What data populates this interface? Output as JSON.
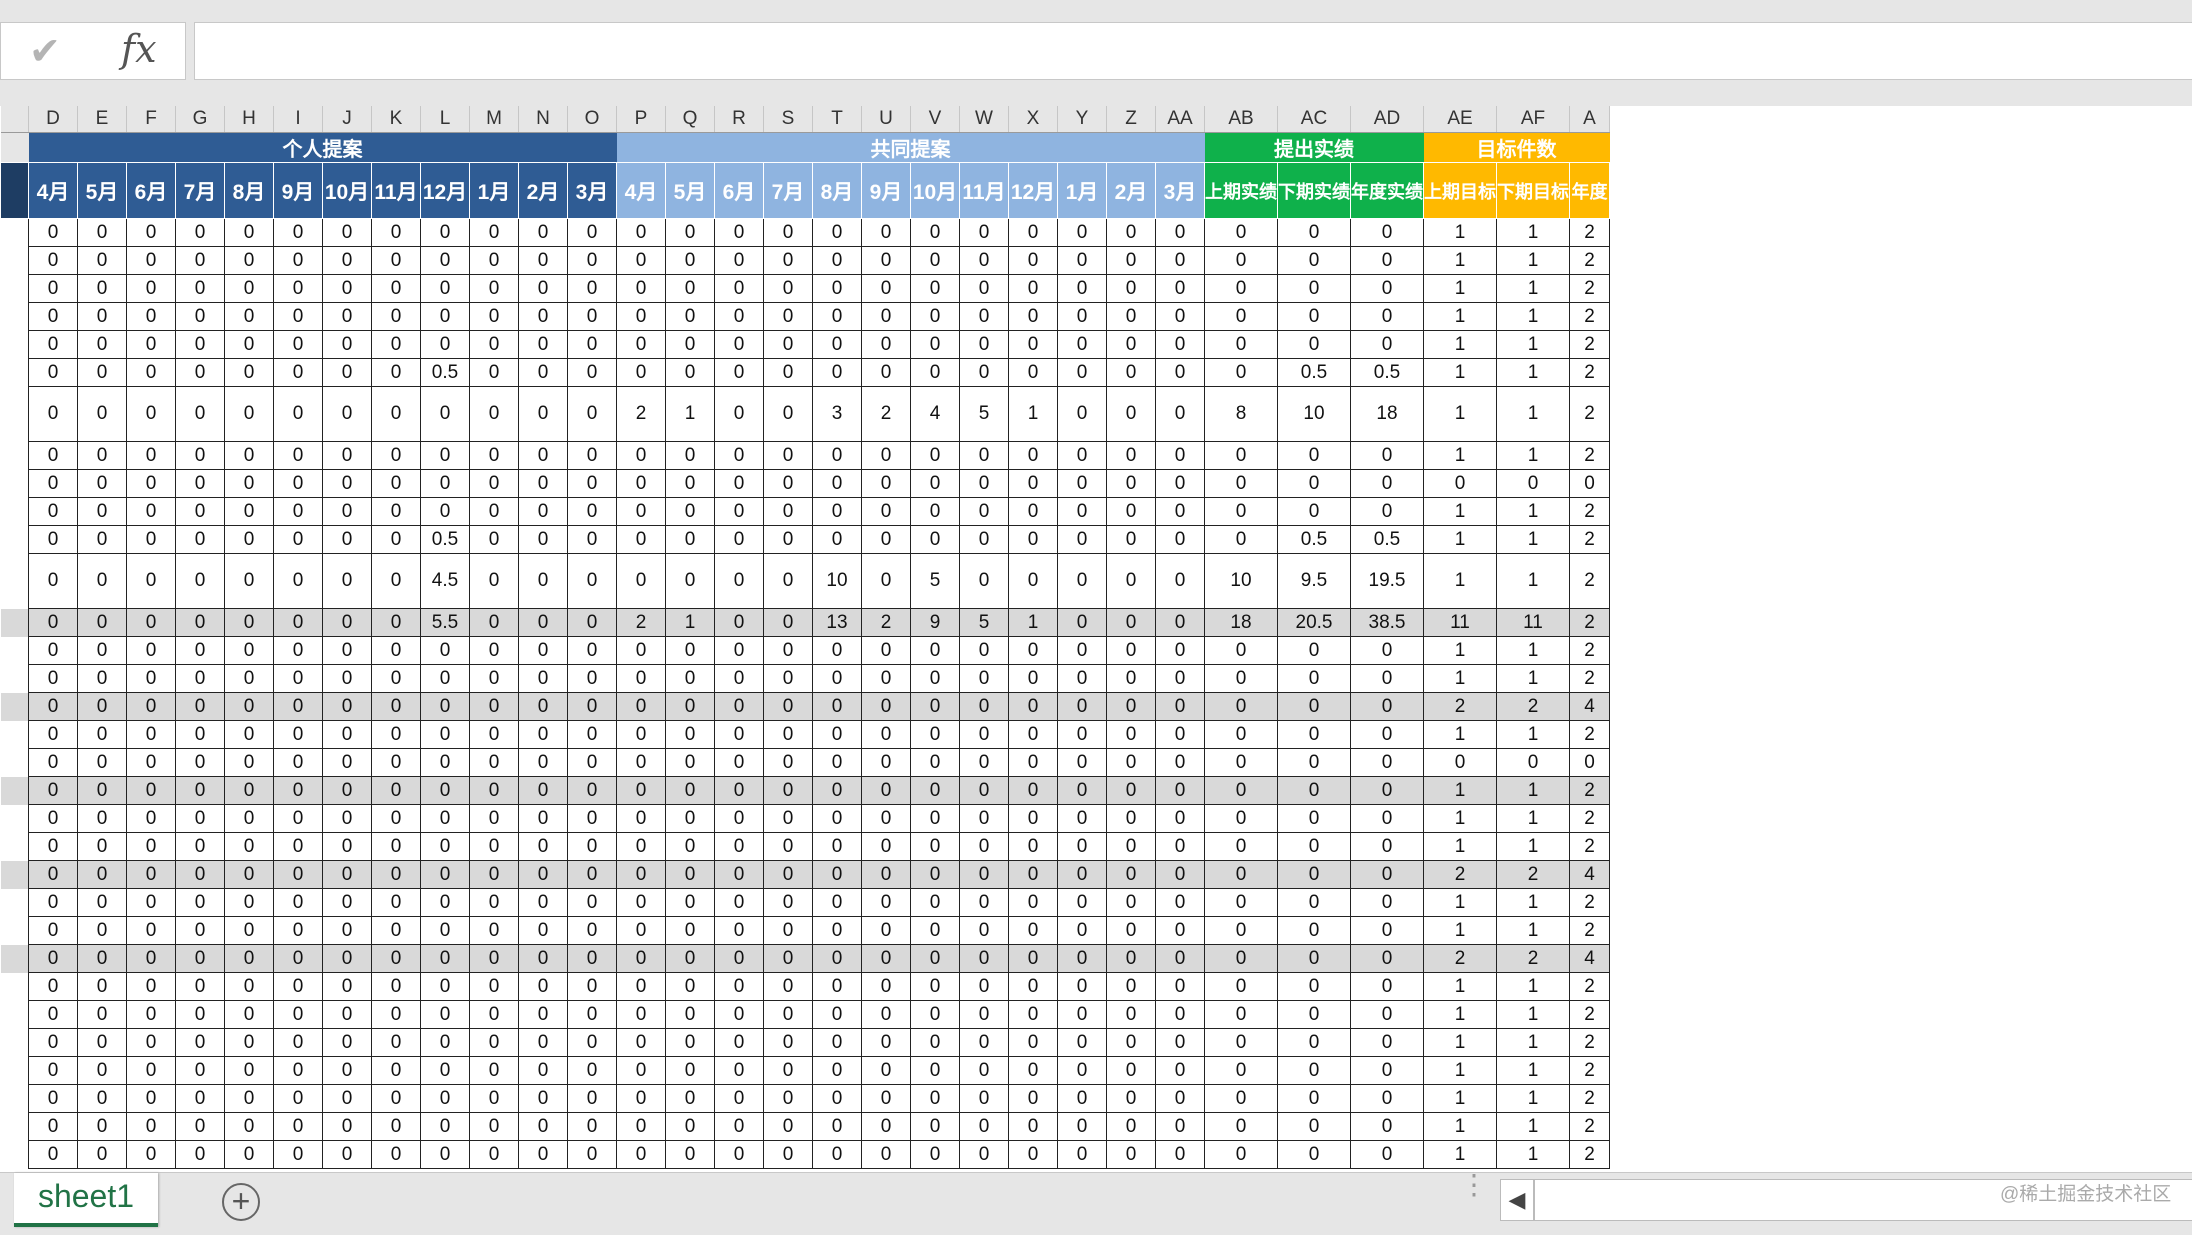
{
  "formula_bar": {
    "check_glyph": "✔",
    "fx_glyph": "fx",
    "value": ""
  },
  "col_letters": [
    "D",
    "E",
    "F",
    "G",
    "H",
    "I",
    "J",
    "K",
    "L",
    "M",
    "N",
    "O",
    "P",
    "Q",
    "R",
    "S",
    "T",
    "U",
    "V",
    "W",
    "X",
    "Y",
    "Z",
    "AA",
    "AB",
    "AC",
    "AD",
    "AE",
    "AF",
    "A"
  ],
  "groups": [
    {
      "label": "个人提案",
      "span": 12,
      "color": "#2f5c94"
    },
    {
      "label": "共同提案",
      "span": 12,
      "color": "#8fb4e0"
    },
    {
      "label": "提出实绩",
      "span": 3,
      "color": "#0fb14b"
    },
    {
      "label": "目标件数",
      "span": 3,
      "color": "#ffb900"
    }
  ],
  "month_headers": [
    "4月",
    "5月",
    "6月",
    "7月",
    "8月",
    "9月",
    "10月",
    "11月",
    "12月",
    "1月",
    "2月",
    "3月",
    "4月",
    "5月",
    "6月",
    "7月",
    "8月",
    "9月",
    "10月",
    "11月",
    "12月",
    "1月",
    "2月",
    "3月",
    "上期实绩",
    "下期实绩",
    "年度实绩",
    "上期目标",
    "下期目标",
    "年度"
  ],
  "rows": [
    {
      "h": 28,
      "s": 0,
      "c": [
        "0",
        "0",
        "0",
        "0",
        "0",
        "0",
        "0",
        "0",
        "0",
        "0",
        "0",
        "0",
        "0",
        "0",
        "0",
        "0",
        "0",
        "0",
        "0",
        "0",
        "0",
        "0",
        "0",
        "0",
        "0",
        "0",
        "0",
        "1",
        "1",
        "2"
      ]
    },
    {
      "h": 28,
      "s": 0,
      "c": [
        "0",
        "0",
        "0",
        "0",
        "0",
        "0",
        "0",
        "0",
        "0",
        "0",
        "0",
        "0",
        "0",
        "0",
        "0",
        "0",
        "0",
        "0",
        "0",
        "0",
        "0",
        "0",
        "0",
        "0",
        "0",
        "0",
        "0",
        "1",
        "1",
        "2"
      ]
    },
    {
      "h": 28,
      "s": 0,
      "c": [
        "0",
        "0",
        "0",
        "0",
        "0",
        "0",
        "0",
        "0",
        "0",
        "0",
        "0",
        "0",
        "0",
        "0",
        "0",
        "0",
        "0",
        "0",
        "0",
        "0",
        "0",
        "0",
        "0",
        "0",
        "0",
        "0",
        "0",
        "1",
        "1",
        "2"
      ]
    },
    {
      "h": 28,
      "s": 0,
      "c": [
        "0",
        "0",
        "0",
        "0",
        "0",
        "0",
        "0",
        "0",
        "0",
        "0",
        "0",
        "0",
        "0",
        "0",
        "0",
        "0",
        "0",
        "0",
        "0",
        "0",
        "0",
        "0",
        "0",
        "0",
        "0",
        "0",
        "0",
        "1",
        "1",
        "2"
      ]
    },
    {
      "h": 28,
      "s": 0,
      "c": [
        "0",
        "0",
        "0",
        "0",
        "0",
        "0",
        "0",
        "0",
        "0",
        "0",
        "0",
        "0",
        "0",
        "0",
        "0",
        "0",
        "0",
        "0",
        "0",
        "0",
        "0",
        "0",
        "0",
        "0",
        "0",
        "0",
        "0",
        "1",
        "1",
        "2"
      ]
    },
    {
      "h": 28,
      "s": 0,
      "c": [
        "0",
        "0",
        "0",
        "0",
        "0",
        "0",
        "0",
        "0",
        "0.5",
        "0",
        "0",
        "0",
        "0",
        "0",
        "0",
        "0",
        "0",
        "0",
        "0",
        "0",
        "0",
        "0",
        "0",
        "0",
        "0",
        "0.5",
        "0.5",
        "1",
        "1",
        "2"
      ]
    },
    {
      "h": 55,
      "s": 0,
      "c": [
        "0",
        "0",
        "0",
        "0",
        "0",
        "0",
        "0",
        "0",
        "0",
        "0",
        "0",
        "0",
        "2",
        "1",
        "0",
        "0",
        "3",
        "2",
        "4",
        "5",
        "1",
        "0",
        "0",
        "0",
        "8",
        "10",
        "18",
        "1",
        "1",
        "2"
      ]
    },
    {
      "h": 28,
      "s": 0,
      "c": [
        "0",
        "0",
        "0",
        "0",
        "0",
        "0",
        "0",
        "0",
        "0",
        "0",
        "0",
        "0",
        "0",
        "0",
        "0",
        "0",
        "0",
        "0",
        "0",
        "0",
        "0",
        "0",
        "0",
        "0",
        "0",
        "0",
        "0",
        "1",
        "1",
        "2"
      ]
    },
    {
      "h": 28,
      "s": 0,
      "c": [
        "0",
        "0",
        "0",
        "0",
        "0",
        "0",
        "0",
        "0",
        "0",
        "0",
        "0",
        "0",
        "0",
        "0",
        "0",
        "0",
        "0",
        "0",
        "0",
        "0",
        "0",
        "0",
        "0",
        "0",
        "0",
        "0",
        "0",
        "0",
        "0",
        "0"
      ]
    },
    {
      "h": 28,
      "s": 0,
      "c": [
        "0",
        "0",
        "0",
        "0",
        "0",
        "0",
        "0",
        "0",
        "0",
        "0",
        "0",
        "0",
        "0",
        "0",
        "0",
        "0",
        "0",
        "0",
        "0",
        "0",
        "0",
        "0",
        "0",
        "0",
        "0",
        "0",
        "0",
        "1",
        "1",
        "2"
      ]
    },
    {
      "h": 28,
      "s": 0,
      "c": [
        "0",
        "0",
        "0",
        "0",
        "0",
        "0",
        "0",
        "0",
        "0.5",
        "0",
        "0",
        "0",
        "0",
        "0",
        "0",
        "0",
        "0",
        "0",
        "0",
        "0",
        "0",
        "0",
        "0",
        "0",
        "0",
        "0.5",
        "0.5",
        "1",
        "1",
        "2"
      ]
    },
    {
      "h": 55,
      "s": 0,
      "c": [
        "0",
        "0",
        "0",
        "0",
        "0",
        "0",
        "0",
        "0",
        "4.5",
        "0",
        "0",
        "0",
        "0",
        "0",
        "0",
        "0",
        "10",
        "0",
        "5",
        "0",
        "0",
        "0",
        "0",
        "0",
        "10",
        "9.5",
        "19.5",
        "1",
        "1",
        "2"
      ]
    },
    {
      "h": 28,
      "s": 1,
      "c": [
        "0",
        "0",
        "0",
        "0",
        "0",
        "0",
        "0",
        "0",
        "5.5",
        "0",
        "0",
        "0",
        "2",
        "1",
        "0",
        "0",
        "13",
        "2",
        "9",
        "5",
        "1",
        "0",
        "0",
        "0",
        "18",
        "20.5",
        "38.5",
        "11",
        "11",
        "2"
      ]
    },
    {
      "h": 28,
      "s": 0,
      "c": [
        "0",
        "0",
        "0",
        "0",
        "0",
        "0",
        "0",
        "0",
        "0",
        "0",
        "0",
        "0",
        "0",
        "0",
        "0",
        "0",
        "0",
        "0",
        "0",
        "0",
        "0",
        "0",
        "0",
        "0",
        "0",
        "0",
        "0",
        "1",
        "1",
        "2"
      ]
    },
    {
      "h": 28,
      "s": 0,
      "c": [
        "0",
        "0",
        "0",
        "0",
        "0",
        "0",
        "0",
        "0",
        "0",
        "0",
        "0",
        "0",
        "0",
        "0",
        "0",
        "0",
        "0",
        "0",
        "0",
        "0",
        "0",
        "0",
        "0",
        "0",
        "0",
        "0",
        "0",
        "1",
        "1",
        "2"
      ]
    },
    {
      "h": 28,
      "s": 1,
      "c": [
        "0",
        "0",
        "0",
        "0",
        "0",
        "0",
        "0",
        "0",
        "0",
        "0",
        "0",
        "0",
        "0",
        "0",
        "0",
        "0",
        "0",
        "0",
        "0",
        "0",
        "0",
        "0",
        "0",
        "0",
        "0",
        "0",
        "0",
        "2",
        "2",
        "4"
      ]
    },
    {
      "h": 28,
      "s": 0,
      "c": [
        "0",
        "0",
        "0",
        "0",
        "0",
        "0",
        "0",
        "0",
        "0",
        "0",
        "0",
        "0",
        "0",
        "0",
        "0",
        "0",
        "0",
        "0",
        "0",
        "0",
        "0",
        "0",
        "0",
        "0",
        "0",
        "0",
        "0",
        "1",
        "1",
        "2"
      ]
    },
    {
      "h": 28,
      "s": 0,
      "c": [
        "0",
        "0",
        "0",
        "0",
        "0",
        "0",
        "0",
        "0",
        "0",
        "0",
        "0",
        "0",
        "0",
        "0",
        "0",
        "0",
        "0",
        "0",
        "0",
        "0",
        "0",
        "0",
        "0",
        "0",
        "0",
        "0",
        "0",
        "0",
        "0",
        "0"
      ]
    },
    {
      "h": 28,
      "s": 1,
      "c": [
        "0",
        "0",
        "0",
        "0",
        "0",
        "0",
        "0",
        "0",
        "0",
        "0",
        "0",
        "0",
        "0",
        "0",
        "0",
        "0",
        "0",
        "0",
        "0",
        "0",
        "0",
        "0",
        "0",
        "0",
        "0",
        "0",
        "0",
        "1",
        "1",
        "2"
      ]
    },
    {
      "h": 28,
      "s": 0,
      "c": [
        "0",
        "0",
        "0",
        "0",
        "0",
        "0",
        "0",
        "0",
        "0",
        "0",
        "0",
        "0",
        "0",
        "0",
        "0",
        "0",
        "0",
        "0",
        "0",
        "0",
        "0",
        "0",
        "0",
        "0",
        "0",
        "0",
        "0",
        "1",
        "1",
        "2"
      ]
    },
    {
      "h": 28,
      "s": 0,
      "c": [
        "0",
        "0",
        "0",
        "0",
        "0",
        "0",
        "0",
        "0",
        "0",
        "0",
        "0",
        "0",
        "0",
        "0",
        "0",
        "0",
        "0",
        "0",
        "0",
        "0",
        "0",
        "0",
        "0",
        "0",
        "0",
        "0",
        "0",
        "1",
        "1",
        "2"
      ]
    },
    {
      "h": 28,
      "s": 1,
      "c": [
        "0",
        "0",
        "0",
        "0",
        "0",
        "0",
        "0",
        "0",
        "0",
        "0",
        "0",
        "0",
        "0",
        "0",
        "0",
        "0",
        "0",
        "0",
        "0",
        "0",
        "0",
        "0",
        "0",
        "0",
        "0",
        "0",
        "0",
        "2",
        "2",
        "4"
      ]
    },
    {
      "h": 28,
      "s": 0,
      "c": [
        "0",
        "0",
        "0",
        "0",
        "0",
        "0",
        "0",
        "0",
        "0",
        "0",
        "0",
        "0",
        "0",
        "0",
        "0",
        "0",
        "0",
        "0",
        "0",
        "0",
        "0",
        "0",
        "0",
        "0",
        "0",
        "0",
        "0",
        "1",
        "1",
        "2"
      ]
    },
    {
      "h": 28,
      "s": 0,
      "c": [
        "0",
        "0",
        "0",
        "0",
        "0",
        "0",
        "0",
        "0",
        "0",
        "0",
        "0",
        "0",
        "0",
        "0",
        "0",
        "0",
        "0",
        "0",
        "0",
        "0",
        "0",
        "0",
        "0",
        "0",
        "0",
        "0",
        "0",
        "1",
        "1",
        "2"
      ]
    },
    {
      "h": 28,
      "s": 1,
      "c": [
        "0",
        "0",
        "0",
        "0",
        "0",
        "0",
        "0",
        "0",
        "0",
        "0",
        "0",
        "0",
        "0",
        "0",
        "0",
        "0",
        "0",
        "0",
        "0",
        "0",
        "0",
        "0",
        "0",
        "0",
        "0",
        "0",
        "0",
        "2",
        "2",
        "4"
      ]
    },
    {
      "h": 28,
      "s": 0,
      "c": [
        "0",
        "0",
        "0",
        "0",
        "0",
        "0",
        "0",
        "0",
        "0",
        "0",
        "0",
        "0",
        "0",
        "0",
        "0",
        "0",
        "0",
        "0",
        "0",
        "0",
        "0",
        "0",
        "0",
        "0",
        "0",
        "0",
        "0",
        "1",
        "1",
        "2"
      ]
    },
    {
      "h": 28,
      "s": 0,
      "c": [
        "0",
        "0",
        "0",
        "0",
        "0",
        "0",
        "0",
        "0",
        "0",
        "0",
        "0",
        "0",
        "0",
        "0",
        "0",
        "0",
        "0",
        "0",
        "0",
        "0",
        "0",
        "0",
        "0",
        "0",
        "0",
        "0",
        "0",
        "1",
        "1",
        "2"
      ]
    },
    {
      "h": 28,
      "s": 0,
      "c": [
        "0",
        "0",
        "0",
        "0",
        "0",
        "0",
        "0",
        "0",
        "0",
        "0",
        "0",
        "0",
        "0",
        "0",
        "0",
        "0",
        "0",
        "0",
        "0",
        "0",
        "0",
        "0",
        "0",
        "0",
        "0",
        "0",
        "0",
        "1",
        "1",
        "2"
      ]
    },
    {
      "h": 28,
      "s": 0,
      "c": [
        "0",
        "0",
        "0",
        "0",
        "0",
        "0",
        "0",
        "0",
        "0",
        "0",
        "0",
        "0",
        "0",
        "0",
        "0",
        "0",
        "0",
        "0",
        "0",
        "0",
        "0",
        "0",
        "0",
        "0",
        "0",
        "0",
        "0",
        "1",
        "1",
        "2"
      ]
    },
    {
      "h": 28,
      "s": 0,
      "c": [
        "0",
        "0",
        "0",
        "0",
        "0",
        "0",
        "0",
        "0",
        "0",
        "0",
        "0",
        "0",
        "0",
        "0",
        "0",
        "0",
        "0",
        "0",
        "0",
        "0",
        "0",
        "0",
        "0",
        "0",
        "0",
        "0",
        "0",
        "1",
        "1",
        "2"
      ]
    },
    {
      "h": 28,
      "s": 0,
      "c": [
        "0",
        "0",
        "0",
        "0",
        "0",
        "0",
        "0",
        "0",
        "0",
        "0",
        "0",
        "0",
        "0",
        "0",
        "0",
        "0",
        "0",
        "0",
        "0",
        "0",
        "0",
        "0",
        "0",
        "0",
        "0",
        "0",
        "0",
        "1",
        "1",
        "2"
      ]
    },
    {
      "h": 28,
      "s": 0,
      "c": [
        "0",
        "0",
        "0",
        "0",
        "0",
        "0",
        "0",
        "0",
        "0",
        "0",
        "0",
        "0",
        "0",
        "0",
        "0",
        "0",
        "0",
        "0",
        "0",
        "0",
        "0",
        "0",
        "0",
        "0",
        "0",
        "0",
        "0",
        "1",
        "1",
        "2"
      ]
    }
  ],
  "sheet_tabs": [
    {
      "label": "sheet1",
      "active": true
    }
  ],
  "add_sheet_glyph": "+",
  "tab_dots": "⋮",
  "scroll_left_glyph": "◀",
  "watermark": "@稀土掘金技术社区"
}
